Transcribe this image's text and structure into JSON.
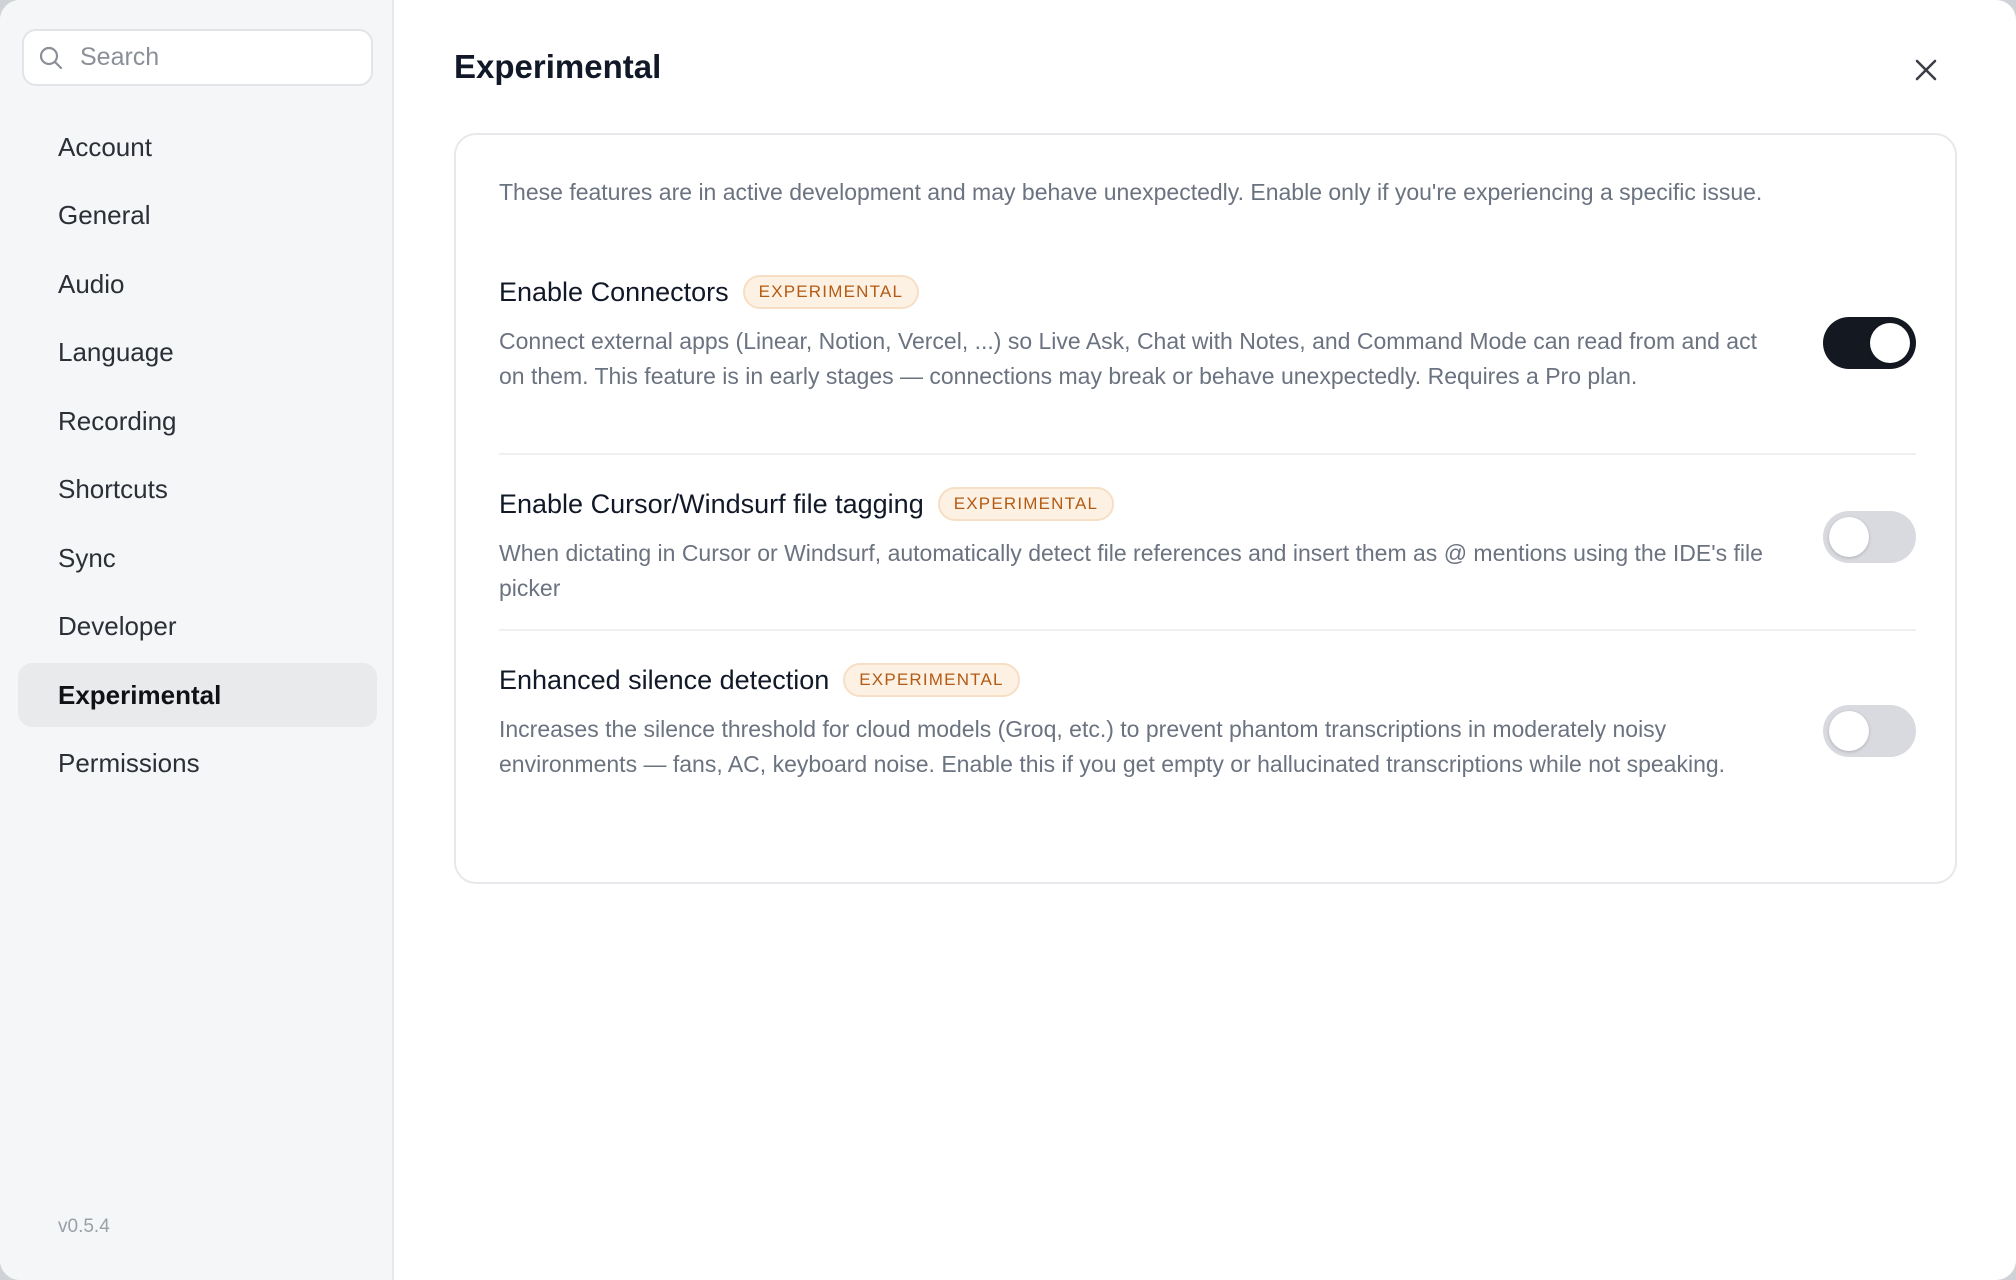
{
  "search": {
    "placeholder": "Search"
  },
  "sidebar": {
    "items": [
      {
        "label": "Account"
      },
      {
        "label": "General"
      },
      {
        "label": "Audio"
      },
      {
        "label": "Language"
      },
      {
        "label": "Recording"
      },
      {
        "label": "Shortcuts"
      },
      {
        "label": "Sync"
      },
      {
        "label": "Developer"
      },
      {
        "label": "Experimental",
        "active": true
      },
      {
        "label": "Permissions"
      }
    ],
    "version": "v0.5.4"
  },
  "main": {
    "title": "Experimental",
    "intro": "These features are in active development and may behave unexpectedly. Enable only if you're experiencing a specific issue.",
    "settings": [
      {
        "title": "Enable Connectors",
        "badge": "EXPERIMENTAL",
        "description": "Connect external apps (Linear, Notion, Vercel, ...) so Live Ask, Chat with Notes, and Command Mode can read from and act on them. This feature is in early stages — connections may break or behave unexpectedly. Requires a Pro plan.",
        "enabled": true
      },
      {
        "title": "Enable Cursor/Windsurf file tagging",
        "badge": "EXPERIMENTAL",
        "description": "When dictating in Cursor or Windsurf, automatically detect file references and insert them as @ mentions using the IDE's file picker",
        "enabled": false
      },
      {
        "title": "Enhanced silence detection",
        "badge": "EXPERIMENTAL",
        "description": "Increases the silence threshold for cloud models (Groq, etc.) to prevent phantom transcriptions in moderately noisy environments — fans, AC, keyboard noise. Enable this if you get empty or hallucinated transcriptions while not speaking.",
        "enabled": false
      }
    ]
  },
  "colors": {
    "toggle_on": "#141821",
    "toggle_off": "#d8dadf",
    "badge_text": "#b45a12",
    "badge_bg": "#fdf1e4"
  }
}
